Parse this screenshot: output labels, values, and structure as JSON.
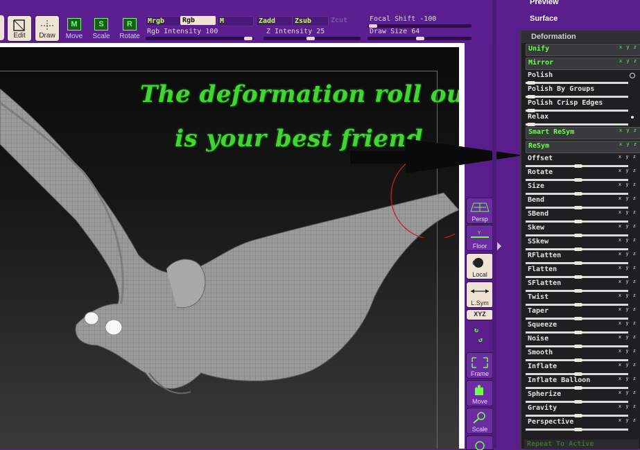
{
  "toolbar": {
    "edit_label": "Edit",
    "draw_label": "Draw",
    "move_label": "Move",
    "scale_label": "Scale",
    "rotate_label": "Rotate",
    "mrgb": "Mrgb",
    "rgb": "Rgb",
    "m": "M",
    "zadd": "Zadd",
    "zsub": "Zsub",
    "zcut": "Zcut",
    "rgb_intensity": "Rgb Intensity 100",
    "z_intensity": "Z Intensity 25",
    "focal_shift": "Focal Shift -100",
    "draw_size": "Draw Size 64"
  },
  "annotation": {
    "line1": "The deformation roll out",
    "line2": "is your best friend"
  },
  "side_controls": {
    "persp": "Persp",
    "floor": "Floor",
    "local": "Local",
    "lsym": "L.Sym",
    "xyz": "XYZ",
    "frame": "Frame",
    "move": "Move",
    "scale": "Scale"
  },
  "top_right": {
    "preview": "Preview",
    "surface": "Surface"
  },
  "panel": {
    "title": "Deformation",
    "green_buttons": [
      "Unify",
      "Mirror",
      "Smart ReSym",
      "ReSym"
    ],
    "items": [
      {
        "name": "Polish"
      },
      {
        "name": "Polish By Groups"
      },
      {
        "name": "Polish Crisp Edges"
      },
      {
        "name": "Relax"
      },
      {
        "name": "Offset"
      },
      {
        "name": "Rotate"
      },
      {
        "name": "Size"
      },
      {
        "name": "Bend"
      },
      {
        "name": "SBend"
      },
      {
        "name": "Skew"
      },
      {
        "name": "SSkew"
      },
      {
        "name": "RFlatten"
      },
      {
        "name": "Flatten"
      },
      {
        "name": "SFlatten"
      },
      {
        "name": "Twist"
      },
      {
        "name": "Taper"
      },
      {
        "name": "Squeeze"
      },
      {
        "name": "Noise"
      },
      {
        "name": "Smooth"
      },
      {
        "name": "Inflate"
      },
      {
        "name": "Inflate Balloon"
      },
      {
        "name": "Spherize"
      },
      {
        "name": "Gravity"
      },
      {
        "name": "Perspective"
      }
    ],
    "repeat_label": "Repeat To Active",
    "xyz_label": "x y z"
  },
  "colors": {
    "ui_purple": "#5a1e8c",
    "accent_green": "#6dff4a",
    "panel_bg": "#1f1f22",
    "annotation_green": "#45d335"
  }
}
